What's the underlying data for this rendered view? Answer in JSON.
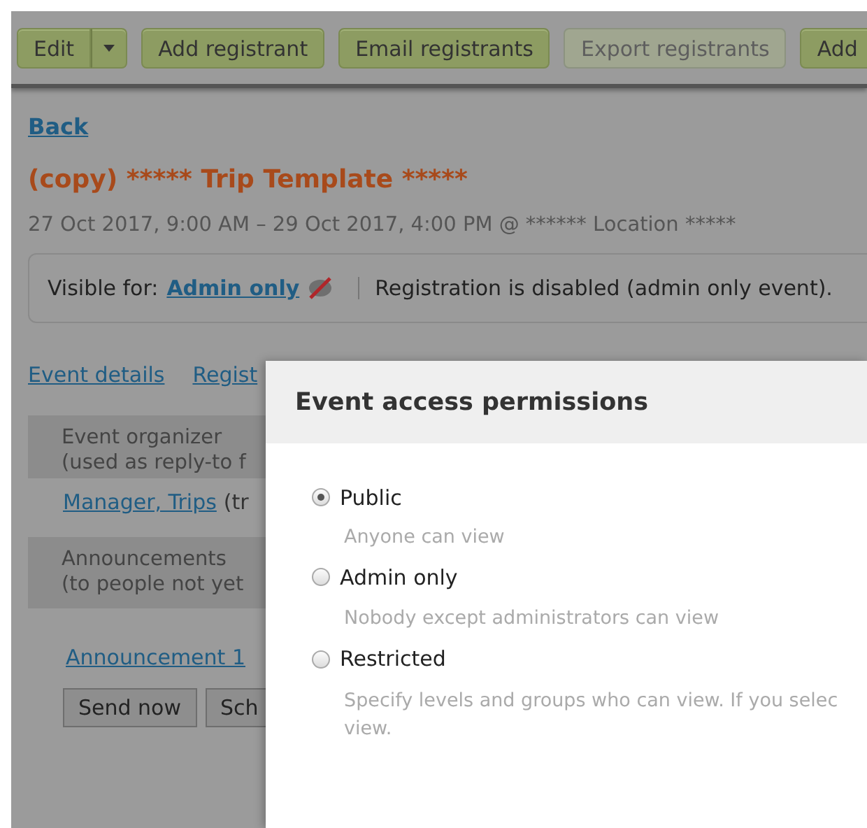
{
  "toolbar": {
    "buttons": [
      {
        "label": "Edit",
        "kind": "split",
        "disabled": false
      },
      {
        "label": "Add registrant",
        "kind": "plain",
        "disabled": false
      },
      {
        "label": "Email registrants",
        "kind": "plain",
        "disabled": false
      },
      {
        "label": "Export registrants",
        "kind": "plain",
        "disabled": true
      },
      {
        "label": "Add",
        "kind": "plain",
        "disabled": false
      }
    ]
  },
  "back_link": "Back",
  "event": {
    "title": "(copy) ***** Trip Template *****",
    "when": "27 Oct 2017, 9:00 AM – 29 Oct 2017, 4:00 PM @ ****** Location *****"
  },
  "visibility": {
    "label": "Visible for:",
    "value": "Admin only",
    "registration": "Registration is disabled (admin only event)."
  },
  "section_links": [
    "Event details",
    "Regist"
  ],
  "organizer": {
    "heading": [
      "Event organizer",
      "(used as reply-to f"
    ],
    "link": "Manager, Trips",
    "note": "(tr"
  },
  "announcements": {
    "heading": [
      "Announcements",
      "(to people not yet"
    ],
    "link": "Announcement 1",
    "buttons": [
      "Send now",
      "Sch"
    ]
  },
  "dialog": {
    "title": "Event access permissions",
    "options": [
      {
        "label": "Public",
        "description": [
          "Anyone can view"
        ],
        "selected": true
      },
      {
        "label": "Admin only",
        "description": [
          "Nobody except administrators can view"
        ],
        "selected": false
      },
      {
        "label": "Restricted",
        "description": [
          "Specify levels and groups who can view. If you selec",
          "view."
        ],
        "selected": false
      }
    ]
  }
}
